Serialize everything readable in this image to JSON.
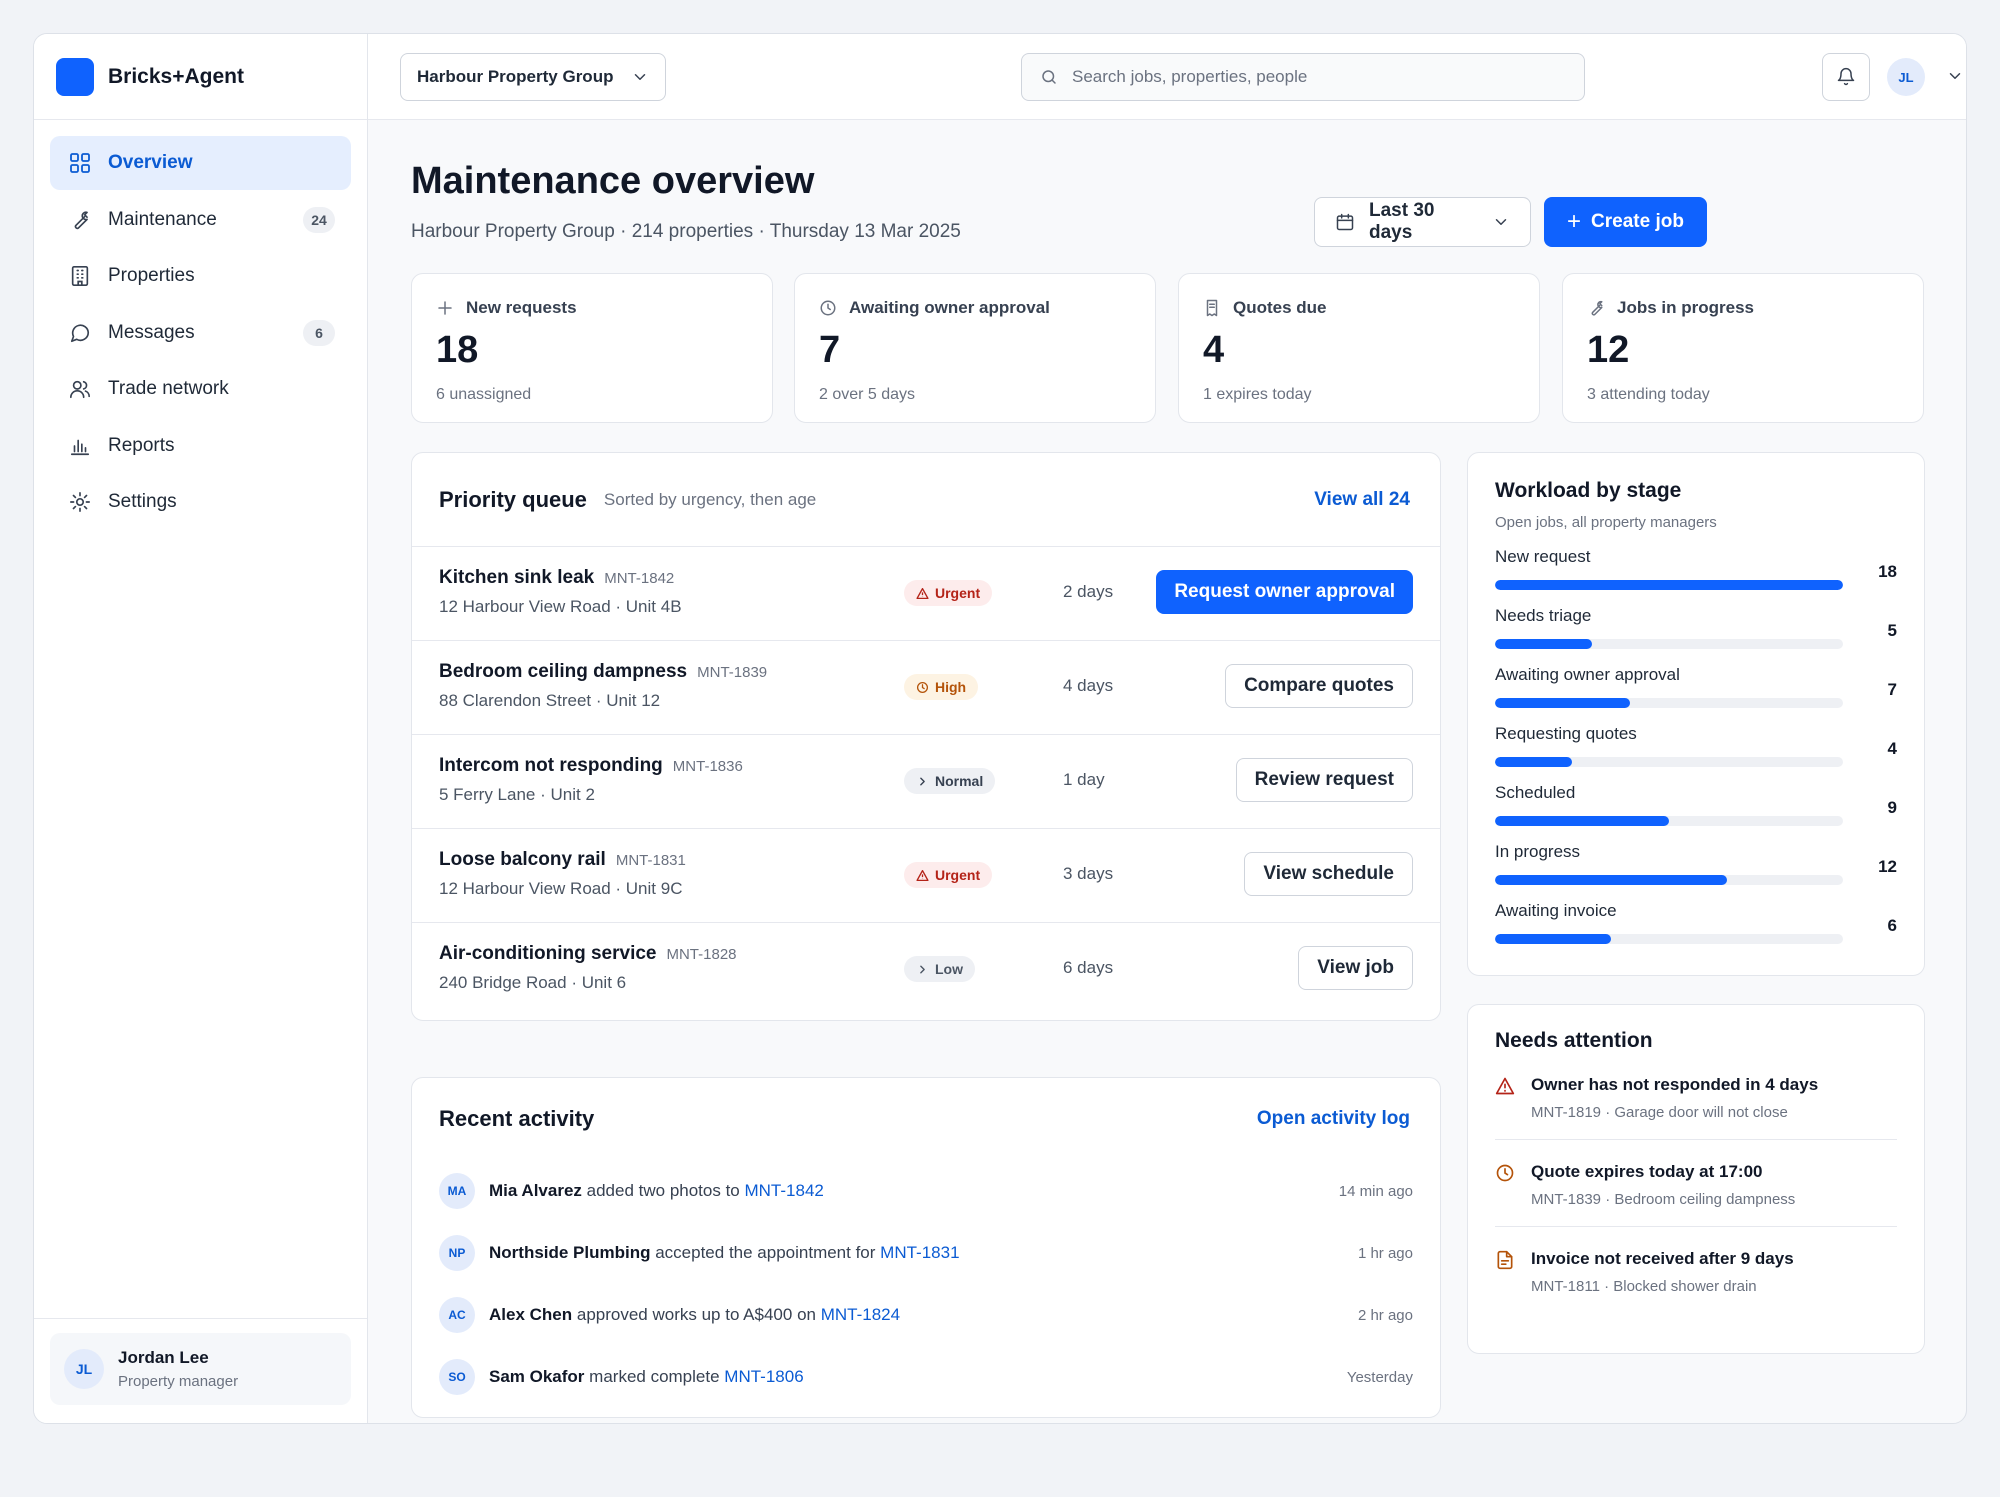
{
  "brand": {
    "name": "Bricks+Agent"
  },
  "sidebar": {
    "items": [
      {
        "label": "Overview",
        "icon": "grid-icon",
        "active": true
      },
      {
        "label": "Maintenance",
        "icon": "wrench-icon",
        "badge": "24"
      },
      {
        "label": "Properties",
        "icon": "building-icon"
      },
      {
        "label": "Messages",
        "icon": "message-icon",
        "badge": "6"
      },
      {
        "label": "Trade network",
        "icon": "users-icon"
      },
      {
        "label": "Reports",
        "icon": "bar-chart-icon"
      },
      {
        "label": "Settings",
        "icon": "gear-icon"
      }
    ],
    "user": {
      "initials": "JL",
      "name": "Jordan Lee",
      "role": "Property manager"
    }
  },
  "topbar": {
    "org": "Harbour Property Group",
    "search_placeholder": "Search jobs, properties, people",
    "avatar_initials": "JL"
  },
  "header": {
    "title": "Maintenance overview",
    "subtitle": "Harbour Property Group · 214 properties · Thursday 13 Mar 2025",
    "range_label": "Last 30 days",
    "create_label": "Create job"
  },
  "kpis": [
    {
      "label": "New requests",
      "value": "18",
      "note": "6 unassigned",
      "icon": "plus-icon"
    },
    {
      "label": "Awaiting owner approval",
      "value": "7",
      "note": "2 over 5 days",
      "icon": "clock-icon"
    },
    {
      "label": "Quotes due",
      "value": "4",
      "note": "1 expires today",
      "icon": "receipt-icon"
    },
    {
      "label": "Jobs in progress",
      "value": "12",
      "note": "3 attending today",
      "icon": "wrench-icon"
    }
  ],
  "priority_queue": {
    "title": "Priority queue",
    "subtitle": "Sorted by urgency, then age",
    "view_all": "View all 24",
    "rows": [
      {
        "title": "Kitchen sink leak",
        "id": "MNT-1842",
        "address": "12 Harbour View Road · Unit 4B",
        "priority": "Urgent",
        "age": "2 days",
        "action": "Request owner approval"
      },
      {
        "title": "Bedroom ceiling dampness",
        "id": "MNT-1839",
        "address": "88 Clarendon Street · Unit 12",
        "priority": "High",
        "age": "4 days",
        "action": "Compare quotes"
      },
      {
        "title": "Intercom not responding",
        "id": "MNT-1836",
        "address": "5 Ferry Lane · Unit 2",
        "priority": "Normal",
        "age": "1 day",
        "action": "Review request"
      },
      {
        "title": "Loose balcony rail",
        "id": "MNT-1831",
        "address": "12 Harbour View Road · Unit 9C",
        "priority": "Urgent",
        "age": "3 days",
        "action": "View schedule"
      },
      {
        "title": "Air-conditioning service",
        "id": "MNT-1828",
        "address": "240 Bridge Road · Unit 6",
        "priority": "Low",
        "age": "6 days",
        "action": "View job"
      }
    ]
  },
  "recent_activity": {
    "title": "Recent activity",
    "link": "Open activity log",
    "rows": [
      {
        "initials": "MA",
        "who": "Mia Alvarez",
        "text": " added two photos to ",
        "ref": "MNT-1842",
        "time": "14 min ago"
      },
      {
        "initials": "NP",
        "who": "Northside Plumbing",
        "text": " accepted the appointment for ",
        "ref": "MNT-1831",
        "time": "1 hr ago"
      },
      {
        "initials": "AC",
        "who": "Alex Chen",
        "text": " approved works up to A$400 on ",
        "ref": "MNT-1824",
        "time": "2 hr ago"
      },
      {
        "initials": "SO",
        "who": "Sam Okafor",
        "text": " marked complete ",
        "ref": "MNT-1806",
        "time": "Yesterday"
      }
    ]
  },
  "workload": {
    "title": "Workload by stage",
    "subtitle": "Open jobs, all property managers",
    "max": 18,
    "stages": [
      {
        "label": "New request",
        "count": 18
      },
      {
        "label": "Needs triage",
        "count": 5
      },
      {
        "label": "Awaiting owner approval",
        "count": 7
      },
      {
        "label": "Requesting quotes",
        "count": 4
      },
      {
        "label": "Scheduled",
        "count": 9
      },
      {
        "label": "In progress",
        "count": 12
      },
      {
        "label": "Awaiting invoice",
        "count": 6
      }
    ]
  },
  "needs_attention": {
    "title": "Needs attention",
    "items": [
      {
        "title": "Owner has not responded in 4 days",
        "sub": "MNT-1819 · Garage door will not close",
        "icon": "warning-icon",
        "color": "#b42318"
      },
      {
        "title": "Quote expires today at 17:00",
        "sub": "MNT-1839 · Bedroom ceiling dampness",
        "icon": "clock-icon",
        "color": "#b45309"
      },
      {
        "title": "Invoice not received after 9 days",
        "sub": "MNT-1811 · Blocked shower drain",
        "icon": "document-icon",
        "color": "#b45309"
      }
    ]
  },
  "colors": {
    "accent": "#0f62fe",
    "urgent": "#b42318",
    "high": "#b45309"
  }
}
